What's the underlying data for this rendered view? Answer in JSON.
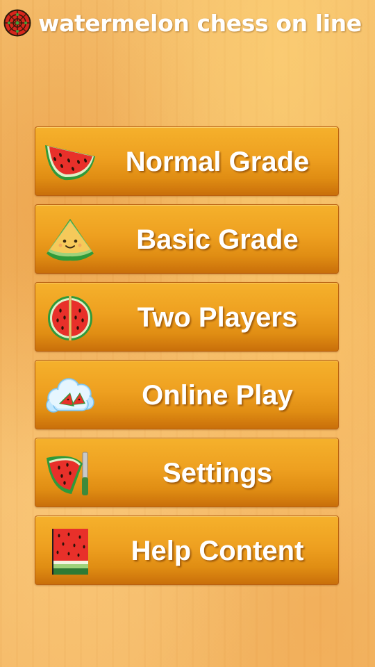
{
  "app": {
    "title": "watermelon chess on line",
    "icon": "crosshair-target-icon"
  },
  "menu": {
    "items": [
      {
        "label": "Normal Grade",
        "icon": "watermelon-slice-icon"
      },
      {
        "label": "Basic Grade",
        "icon": "smiling-melon-slice-icon"
      },
      {
        "label": "Two Players",
        "icon": "halved-watermelon-icon"
      },
      {
        "label": "Online Play",
        "icon": "cloud-watermelon-icon"
      },
      {
        "label": "Settings",
        "icon": "watermelon-knife-icon"
      },
      {
        "label": "Help Content",
        "icon": "watermelon-book-icon"
      }
    ]
  },
  "colors": {
    "background": "#f0b45c",
    "button_top": "#f5b12c",
    "button_bottom": "#c96f0a",
    "button_text": "#ffffff",
    "melon_red": "#e8302a",
    "melon_green": "#2f9a3a"
  }
}
